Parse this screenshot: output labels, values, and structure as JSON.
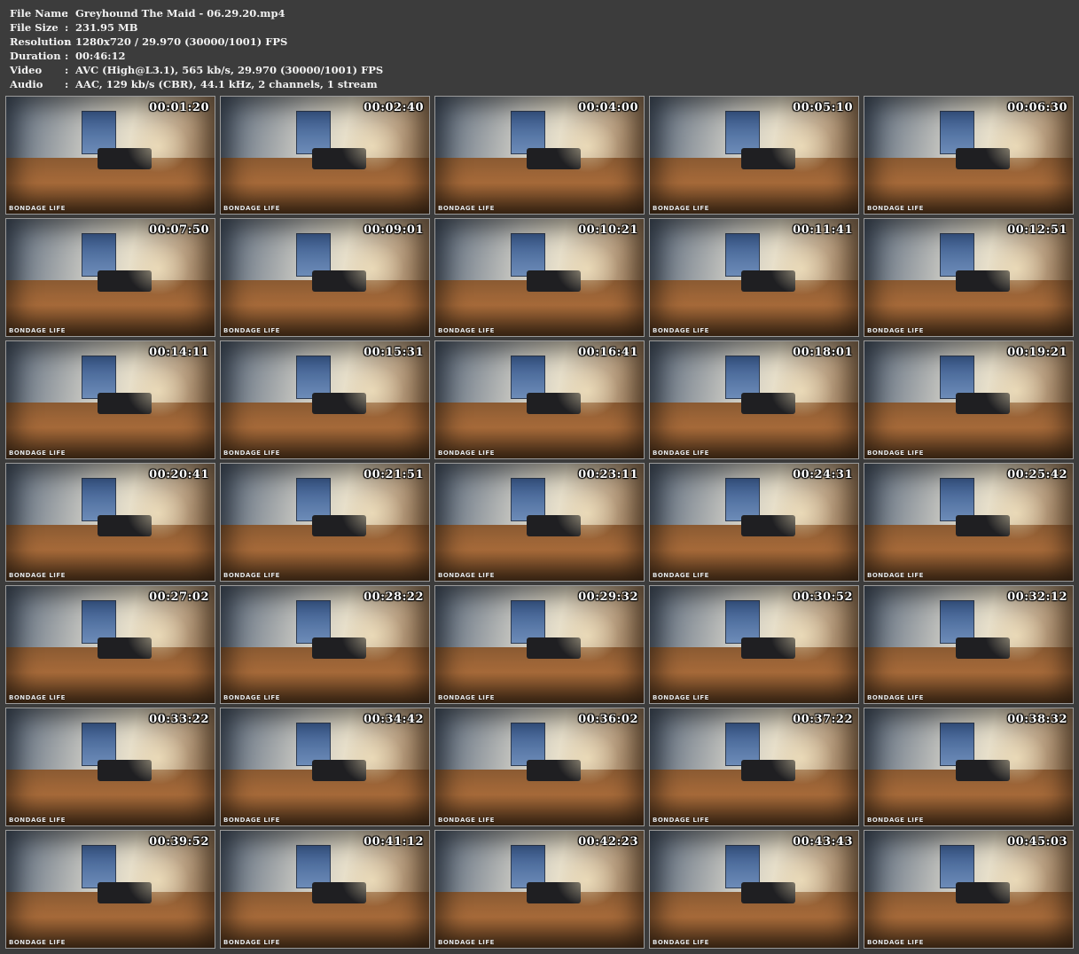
{
  "info": [
    {
      "key": "File Name",
      "sep": ":",
      "value": "Greyhound The Maid - 06.29.20.mp4"
    },
    {
      "key": "File Size",
      "sep": ":",
      "value": "231.95 MB"
    },
    {
      "key": "Resolution",
      "sep": ":",
      "value": "1280x720 / 29.970 (30000/1001) FPS"
    },
    {
      "key": "Duration",
      "sep": ":",
      "value": "00:46:12"
    },
    {
      "key": "Video",
      "sep": ":",
      "value": "AVC (High@L3.1), 565 kb/s, 29.970 (30000/1001) FPS"
    },
    {
      "key": "Audio",
      "sep": ":",
      "value": "AAC, 129 kb/s (CBR), 44.1 kHz, 2 channels, 1 stream"
    }
  ],
  "watermark": "BONDAGE LIFE",
  "thumbnails": [
    "00:01:20",
    "00:02:40",
    "00:04:00",
    "00:05:10",
    "00:06:30",
    "00:07:50",
    "00:09:01",
    "00:10:21",
    "00:11:41",
    "00:12:51",
    "00:14:11",
    "00:15:31",
    "00:16:41",
    "00:18:01",
    "00:19:21",
    "00:20:41",
    "00:21:51",
    "00:23:11",
    "00:24:31",
    "00:25:42",
    "00:27:02",
    "00:28:22",
    "00:29:32",
    "00:30:52",
    "00:32:12",
    "00:33:22",
    "00:34:42",
    "00:36:02",
    "00:37:22",
    "00:38:32",
    "00:39:52",
    "00:41:12",
    "00:42:23",
    "00:43:43",
    "00:45:03"
  ]
}
